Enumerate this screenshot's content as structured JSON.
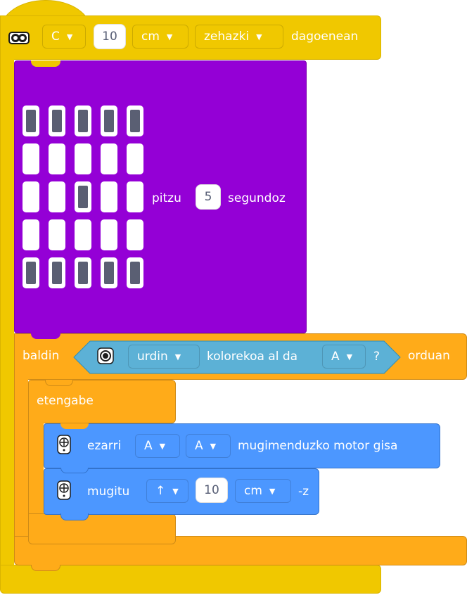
{
  "hat": {
    "port": "C",
    "distance_value": "10",
    "unit": "cm",
    "comparison": "zehazki",
    "suffix": "dagoenean",
    "icon": "distance-sensor-icon"
  },
  "light_matrix": {
    "label_before": "pitzu",
    "seconds_value": "5",
    "label_after": "segundoz",
    "grid": [
      [
        1,
        1,
        1,
        1,
        1
      ],
      [
        0,
        0,
        0,
        0,
        0
      ],
      [
        0,
        0,
        1,
        0,
        0
      ],
      [
        0,
        0,
        0,
        0,
        0
      ],
      [
        1,
        1,
        1,
        1,
        1
      ]
    ]
  },
  "if_block": {
    "keyword": "baldin",
    "color": "urdin",
    "mid_text": "kolorekoa al da",
    "port": "A",
    "question": "?",
    "then": "orduan",
    "icon": "color-sensor-icon"
  },
  "forever": {
    "label": "etengabe"
  },
  "motor_set": {
    "label": "ezarri",
    "left_port": "A",
    "right_port": "A",
    "suffix": "mugimenduzko motor gisa",
    "icon": "motor-icon"
  },
  "motor_move": {
    "label": "mugitu",
    "direction": "↑",
    "value": "10",
    "unit": "cm",
    "suffix": "-z",
    "icon": "motor-icon"
  },
  "colors": {
    "events": "#f0c800",
    "display": "#9400d6",
    "control": "#ffab19",
    "sensors": "#5cb1d6",
    "motion": "#4c97ff"
  }
}
